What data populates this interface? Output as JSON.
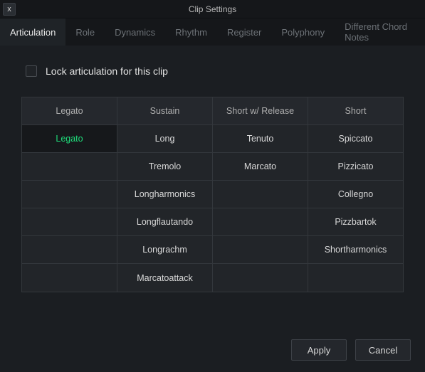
{
  "title": "Clip Settings",
  "close_glyph": "x",
  "tabs": [
    "Articulation",
    "Role",
    "Dynamics",
    "Rhythm",
    "Register",
    "Polyphony",
    "Different Chord Notes"
  ],
  "active_tab_index": 0,
  "checkbox": {
    "label": "Lock articulation for this clip",
    "checked": false
  },
  "table": {
    "headers": [
      "Legato",
      "Sustain",
      "Short w/ Release",
      "Short"
    ],
    "rows": [
      [
        "Legato",
        "Long",
        "Tenuto",
        "Spiccato"
      ],
      [
        "",
        "Tremolo",
        "Marcato",
        "Pizzicato"
      ],
      [
        "",
        "Longharmonics",
        "",
        "Collegno"
      ],
      [
        "",
        "Longflautando",
        "",
        "Pizzbartok"
      ],
      [
        "",
        "Longrachm",
        "",
        "Shortharmonics"
      ],
      [
        "",
        "Marcatoattack",
        "",
        ""
      ]
    ],
    "selected": {
      "row": 0,
      "col": 0
    }
  },
  "buttons": {
    "apply": "Apply",
    "cancel": "Cancel"
  }
}
